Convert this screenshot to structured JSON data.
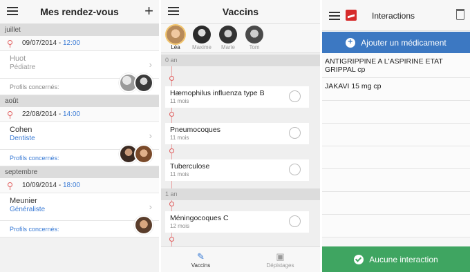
{
  "rendezvous": {
    "title": "Mes rendez-vous",
    "profiles_label": "Profils concernés:",
    "sections": [
      {
        "month": "juillet",
        "date": "09/07/2014",
        "time": "12:00",
        "name": "Huot",
        "specialty": "Pédiatre",
        "dim": true
      },
      {
        "month": "août",
        "date": "22/08/2014",
        "time": "14:00",
        "name": "Cohen",
        "specialty": "Dentiste",
        "dim": false
      },
      {
        "month": "septembre",
        "date": "10/09/2014",
        "time": "18:00",
        "name": "Meunier",
        "specialty": "Généraliste",
        "dim": false
      }
    ],
    "colors": {
      "accent": "#3a7bd5",
      "pin": "#e05a5a"
    }
  },
  "vaccins": {
    "title": "Vaccins",
    "profiles": [
      "Léa",
      "Maxime",
      "Marie",
      "Tom"
    ],
    "age_groups": [
      "0 an",
      "1 an"
    ],
    "items": [
      {
        "name": "Hæmophilus influenza type B",
        "age": "11 mois"
      },
      {
        "name": "Pneumocoques",
        "age": "11 mois"
      },
      {
        "name": "Tuberculose",
        "age": "11 mois"
      },
      {
        "name": "Méningocoques C",
        "age": "12 mois"
      }
    ],
    "tabs": [
      "Vaccins",
      "Dépistages"
    ]
  },
  "interactions": {
    "title": "Interactions",
    "add_button": "Ajouter un médicament",
    "medications": [
      "ANTIGRIPPINE A L'ASPIRINE ETAT GRIPPAL cp",
      "JAKAVI 15 mg cp"
    ],
    "result_button": "Aucune interaction",
    "colors": {
      "add": "#3c78c2",
      "ok": "#3fa561"
    }
  }
}
